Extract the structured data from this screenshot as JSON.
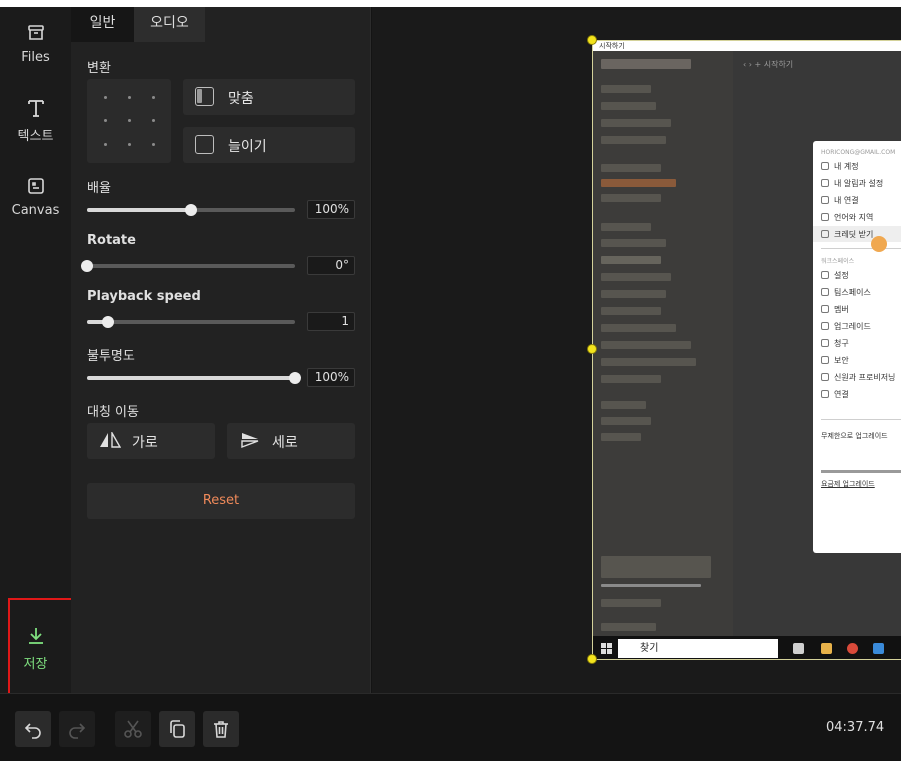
{
  "rail": {
    "files": "Files",
    "text": "텍스트",
    "canvas": "Canvas",
    "save": "저장"
  },
  "panel": {
    "tabs": [
      "일반",
      "오디오"
    ],
    "transform_label": "변환",
    "fit_label": "맞춤",
    "stretch_label": "늘이기",
    "scale": {
      "label": "배율",
      "value_text": "100%",
      "value": 0.5
    },
    "rotate": {
      "label": "Rotate",
      "value_text": "0°",
      "value": 0.0
    },
    "playback": {
      "label": "Playback speed",
      "value_text": "1",
      "value": 0.1
    },
    "opacity": {
      "label": "불투명도",
      "value_text": "100%",
      "value": 1.0
    },
    "flip_label": "대칭 이동",
    "flip_horizontal": "가로",
    "flip_vertical": "세로",
    "reset_label": "Reset"
  },
  "preview": {
    "window_title": "시작하기",
    "breadcrumb": "‹ › + 시작하기",
    "menu_header": "HORICONG@GMAIL.COM",
    "menu_items": [
      "내 계정",
      "내 알림과 설정",
      "내 연결",
      "언어와 지역",
      "크레딧 받기",
      "설정",
      "팀스페이스",
      "멤버",
      "업그레이드",
      "청구",
      "보안",
      "신원과 프로비저닝",
      "연결"
    ],
    "menu_section": "워크스페이스",
    "upgrade_text": "무제한으로 업그레이드",
    "upgrade_link": "요금제 업그레이드",
    "taskbar_search": "찾기"
  },
  "toolbar": {
    "timecode": "04:37.74"
  },
  "colors": {
    "accent_save": "#7fe07f",
    "highlight_box": "#e01818",
    "reset_text": "#f08a5a",
    "handle": "#f3e31c"
  }
}
